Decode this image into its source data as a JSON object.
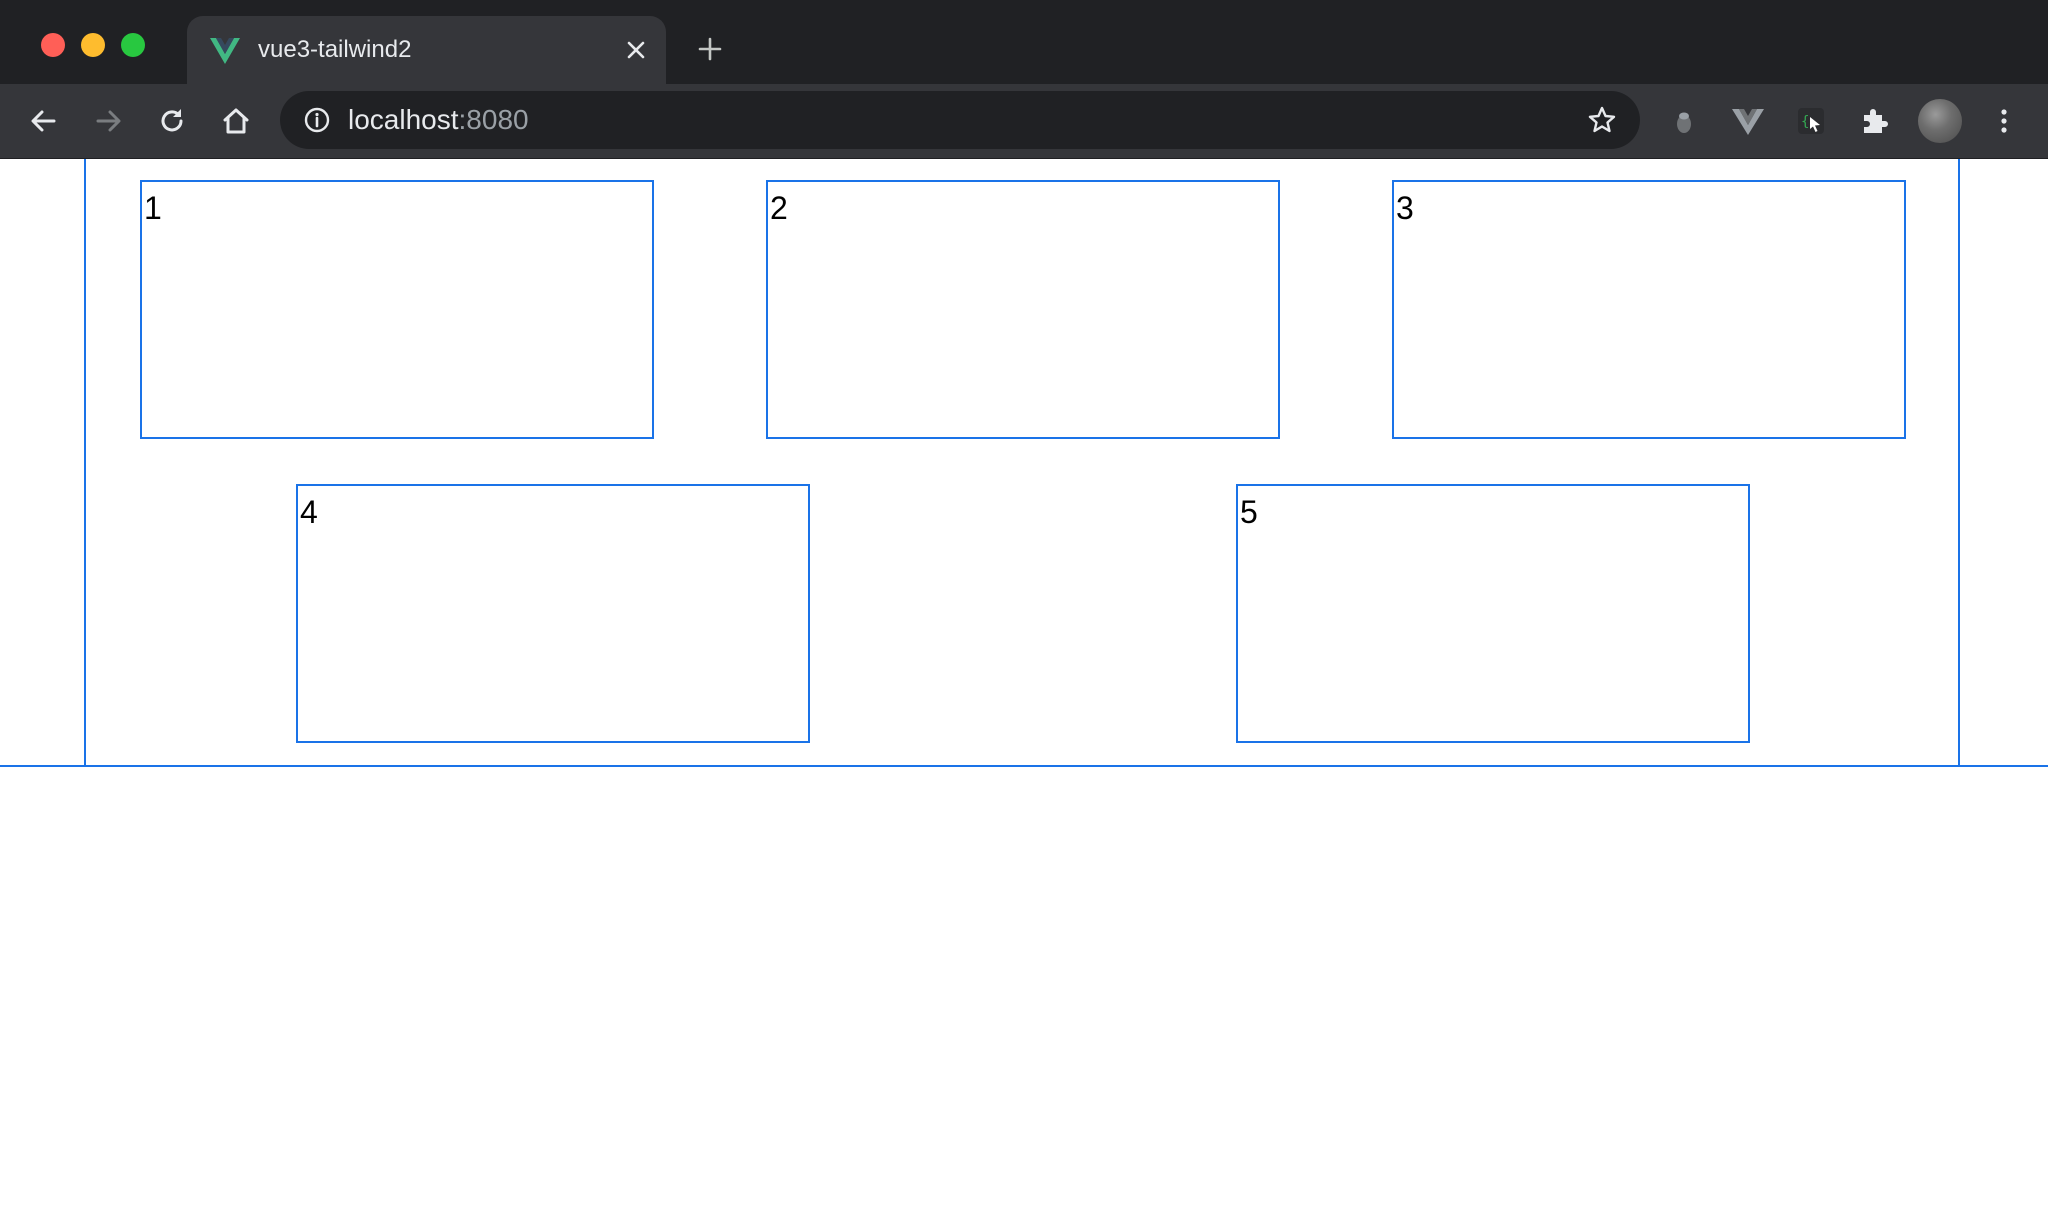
{
  "browser": {
    "tab": {
      "title": "vue3-tailwind2",
      "favicon": "vue-logo-icon"
    },
    "new_tab_icon": "plus-icon",
    "toolbar": {
      "back_icon": "arrow-left-icon",
      "forward_icon": "arrow-right-icon",
      "reload_icon": "reload-icon",
      "home_icon": "home-icon",
      "address": {
        "host": "localhost",
        "port": ":8080",
        "security_icon": "info-icon",
        "bookmark_icon": "star-icon"
      },
      "extensions": [
        "ghost-extension-icon",
        "vue-devtools-icon",
        "code-inspector-icon",
        "puzzle-icon"
      ],
      "menu_icon": "kebab-menu-icon"
    }
  },
  "page": {
    "boxes": [
      {
        "label": "1"
      },
      {
        "label": "2"
      },
      {
        "label": "3"
      },
      {
        "label": "4"
      },
      {
        "label": "5"
      }
    ]
  },
  "colors": {
    "accent_border": "#1a73e8",
    "tabstrip_bg": "#202124",
    "toolbar_bg": "#35363a",
    "vue_green": "#41b883"
  }
}
